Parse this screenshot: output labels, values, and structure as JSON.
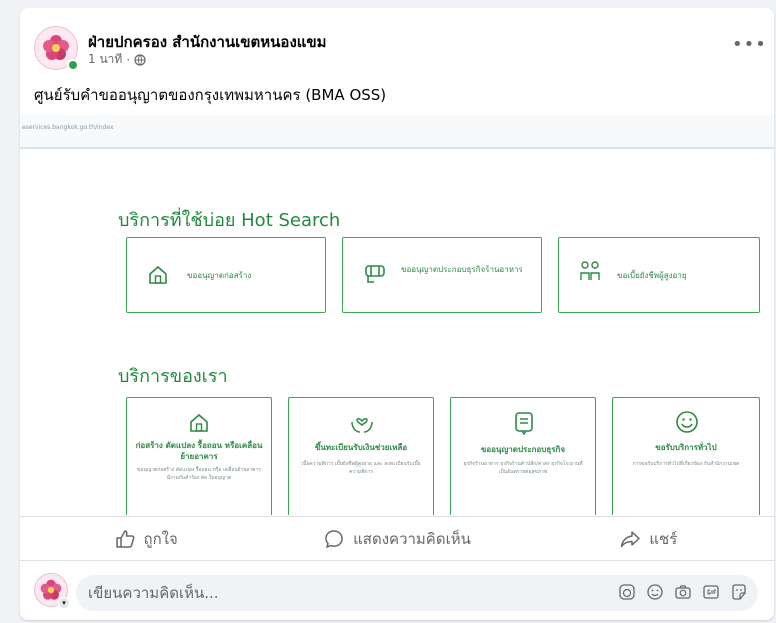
{
  "post": {
    "page_name": "ฝ่ายปกครอง สำนักงานเขตหนองแขม",
    "time": "1 นาที",
    "separator": "·",
    "text": "ศูนย์รับคำขออนุญาตของกรุงเทพมหานคร (BMA OSS)"
  },
  "preview": {
    "url": "eservices.bangkok.go.th/index",
    "hot_search": {
      "title": "บริการที่ใช้บ่อย Hot Search",
      "items": [
        {
          "label": "ขออนุญาตก่อสร้าง",
          "icon": "house-icon"
        },
        {
          "label": "ขออนุญาตประกอบธุรกิจร้านอาหาร",
          "icon": "restaurant-icon"
        },
        {
          "label": "ขอเบี้ยยังชีพผู้สูงอายุ",
          "icon": "elderly-icon"
        }
      ]
    },
    "services": {
      "title": "บริการของเรา",
      "items": [
        {
          "title": "ก่อสร้าง ดัดแปลง รื้อถอน หรือเคลื่อนย้ายอาคาร",
          "desc": "ขอนุญาตก่อสร้าง ดัดแปลง รื้อถอน หรือ เคลื่อนย้ายอาคาร มีงานกับคำร้อง ต่อ ใบอนุญาต",
          "icon": "house-icon"
        },
        {
          "title": "ขึ้นทะเบียนรับเงินช่วยเหลือ",
          "desc": "เบี้ยความพิการ เบี้ยยังชีพผู้สูงอายุ และ ลงทะเบียนรับเบี้ยความพิการ",
          "icon": "hands-heart-icon"
        },
        {
          "title": "ขออนุญาตประกอบธุรกิจ",
          "desc": "ธุรกิจร้านอาหาร ธุรกิจร้านค้าปลีก/ค่าส่ง ธุรกิจโรงงานที่เป็นอันตรายต่อสุขภาพ",
          "icon": "document-icon"
        },
        {
          "title": "ขอรับบริการทั่วไป",
          "desc": "การขอรับบริการทั่วไปที่เกี่ยวข้อง กับสำนักงานเขต",
          "icon": "smile-icon"
        }
      ]
    }
  },
  "actions": {
    "like": "ถูกใจ",
    "comment": "แสดงความคิดเห็น",
    "share": "แชร์"
  },
  "comment_box": {
    "placeholder": "เขียนความคิดเห็น..."
  },
  "colors": {
    "accent_green": "#1f8b3c",
    "online": "#31a24c"
  }
}
